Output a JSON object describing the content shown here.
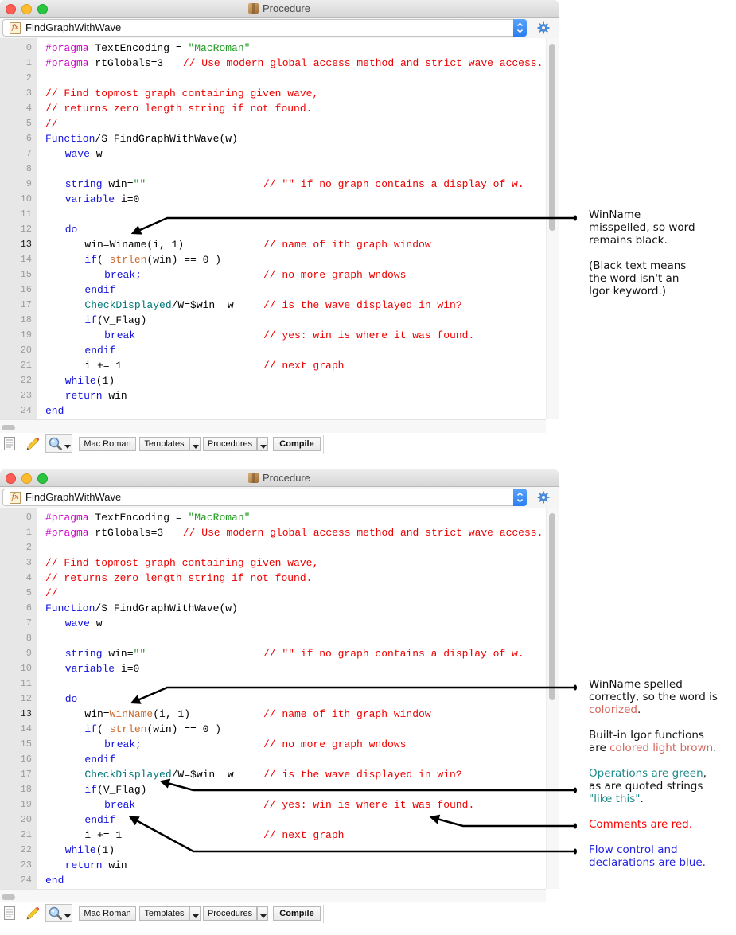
{
  "syntax_colors": {
    "plain": "#000000",
    "pragma": "#cc00c6",
    "comment": "#ee0000",
    "string": "#1f9a1f",
    "keyword": "#1212dc",
    "function": "#cc6a2c",
    "operation": "#00787a"
  },
  "annotation_colors": {
    "black": "#111111",
    "salmon": "#d6655a",
    "teal": "#1e8c8c",
    "red": "#ff0000",
    "blue": "#2424e6"
  },
  "windows": [
    {
      "title": "Procedure",
      "title_icon": "procedure-package-icon",
      "function_selector": {
        "icon_glyph": "fx",
        "value": "FindGraphWithWave"
      },
      "current_line": 13,
      "lines": [
        {
          "n": 0,
          "segments": [
            {
              "type": "pragma",
              "text": "#pragma"
            },
            {
              "type": "plain",
              "text": " TextEncoding = "
            },
            {
              "type": "string",
              "text": "\"MacRoman\""
            }
          ]
        },
        {
          "n": 1,
          "segments": [
            {
              "type": "pragma",
              "text": "#pragma"
            },
            {
              "type": "plain",
              "text": " rtGlobals=3\t"
            },
            {
              "type": "comment",
              "text": "// Use modern global access method and strict wave access."
            }
          ]
        },
        {
          "n": 2,
          "segments": []
        },
        {
          "n": 3,
          "segments": [
            {
              "type": "comment",
              "text": "// Find topmost graph containing given wave,"
            }
          ]
        },
        {
          "n": 4,
          "segments": [
            {
              "type": "comment",
              "text": "// returns zero length string if not found."
            }
          ]
        },
        {
          "n": 5,
          "segments": [
            {
              "type": "comment",
              "text": "//"
            }
          ]
        },
        {
          "n": 6,
          "segments": [
            {
              "type": "keyword",
              "text": "Function"
            },
            {
              "type": "plain",
              "text": "/S FindGraphWithWave(w)"
            }
          ]
        },
        {
          "n": 7,
          "segments": [
            {
              "type": "plain",
              "text": "\t"
            },
            {
              "type": "keyword",
              "text": "wave"
            },
            {
              "type": "plain",
              "text": " w"
            }
          ]
        },
        {
          "n": 8,
          "segments": []
        },
        {
          "n": 9,
          "segments": [
            {
              "type": "plain",
              "text": "\t"
            },
            {
              "type": "keyword",
              "text": "string"
            },
            {
              "type": "plain",
              "text": " win="
            },
            {
              "type": "string",
              "text": "\"\""
            }
          ],
          "comment": "// \"\" if no graph contains a display of w."
        },
        {
          "n": 10,
          "segments": [
            {
              "type": "plain",
              "text": "\t"
            },
            {
              "type": "keyword",
              "text": "variable"
            },
            {
              "type": "plain",
              "text": " i=0"
            }
          ]
        },
        {
          "n": 11,
          "segments": []
        },
        {
          "n": 12,
          "segments": [
            {
              "type": "plain",
              "text": "\t"
            },
            {
              "type": "keyword",
              "text": "do"
            }
          ]
        },
        {
          "n": 13,
          "segments": [
            {
              "type": "plain",
              "text": "\t\twin=Winame(i, 1)"
            }
          ],
          "comment": "// name of ith graph window"
        },
        {
          "n": 14,
          "segments": [
            {
              "type": "plain",
              "text": "\t\t"
            },
            {
              "type": "keyword",
              "text": "if"
            },
            {
              "type": "plain",
              "text": "( "
            },
            {
              "type": "function",
              "text": "strlen"
            },
            {
              "type": "plain",
              "text": "(win) == 0 )"
            }
          ]
        },
        {
          "n": 15,
          "segments": [
            {
              "type": "plain",
              "text": "\t\t\t"
            },
            {
              "type": "keyword",
              "text": "break;"
            }
          ],
          "comment": "// no more graph wndows"
        },
        {
          "n": 16,
          "segments": [
            {
              "type": "plain",
              "text": "\t\t"
            },
            {
              "type": "keyword",
              "text": "endif"
            }
          ]
        },
        {
          "n": 17,
          "segments": [
            {
              "type": "plain",
              "text": "\t\t"
            },
            {
              "type": "operation",
              "text": "CheckDisplayed"
            },
            {
              "type": "plain",
              "text": "/W=$win  w"
            }
          ],
          "comment": "// is the wave displayed in win?"
        },
        {
          "n": 18,
          "segments": [
            {
              "type": "plain",
              "text": "\t\t"
            },
            {
              "type": "keyword",
              "text": "if"
            },
            {
              "type": "plain",
              "text": "(V_Flag)"
            }
          ]
        },
        {
          "n": 19,
          "segments": [
            {
              "type": "plain",
              "text": "\t\t\t"
            },
            {
              "type": "keyword",
              "text": "break"
            }
          ],
          "comment": "// yes: win is where it was found."
        },
        {
          "n": 20,
          "segments": [
            {
              "type": "plain",
              "text": "\t\t"
            },
            {
              "type": "keyword",
              "text": "endif"
            }
          ]
        },
        {
          "n": 21,
          "segments": [
            {
              "type": "plain",
              "text": "\t\ti += 1"
            }
          ],
          "comment": "// next graph"
        },
        {
          "n": 22,
          "segments": [
            {
              "type": "plain",
              "text": "\t"
            },
            {
              "type": "keyword",
              "text": "while"
            },
            {
              "type": "plain",
              "text": "(1)"
            }
          ]
        },
        {
          "n": 23,
          "segments": [
            {
              "type": "plain",
              "text": "\t"
            },
            {
              "type": "keyword",
              "text": "return"
            },
            {
              "type": "plain",
              "text": " win"
            }
          ]
        },
        {
          "n": 24,
          "segments": [
            {
              "type": "keyword",
              "text": "end"
            }
          ]
        }
      ],
      "toolbar": {
        "encoding_button": "Mac Roman",
        "templates_button": "Templates",
        "procedures_button": "Procedures",
        "compile_button": "Compile"
      },
      "annotations": [
        {
          "lines": [
            [
              {
                "text": "WinName",
                "tone": "black"
              }
            ],
            [
              {
                "text": "misspelled, so word",
                "tone": "black"
              }
            ],
            [
              {
                "text": "remains black.",
                "tone": "black"
              }
            ],
            [],
            [
              {
                "text": "(Black text means",
                "tone": "black"
              }
            ],
            [
              {
                "text": "the word isn't an",
                "tone": "black"
              }
            ],
            [
              {
                "text": "Igor keyword.)",
                "tone": "black"
              }
            ]
          ]
        }
      ]
    },
    {
      "title": "Procedure",
      "title_icon": "procedure-package-icon",
      "function_selector": {
        "icon_glyph": "fx",
        "value": "FindGraphWithWave"
      },
      "current_line": 13,
      "lines": [
        {
          "n": 0,
          "segments": [
            {
              "type": "pragma",
              "text": "#pragma"
            },
            {
              "type": "plain",
              "text": " TextEncoding = "
            },
            {
              "type": "string",
              "text": "\"MacRoman\""
            }
          ]
        },
        {
          "n": 1,
          "segments": [
            {
              "type": "pragma",
              "text": "#pragma"
            },
            {
              "type": "plain",
              "text": " rtGlobals=3\t"
            },
            {
              "type": "comment",
              "text": "// Use modern global access method and strict wave access."
            }
          ]
        },
        {
          "n": 2,
          "segments": []
        },
        {
          "n": 3,
          "segments": [
            {
              "type": "comment",
              "text": "// Find topmost graph containing given wave,"
            }
          ]
        },
        {
          "n": 4,
          "segments": [
            {
              "type": "comment",
              "text": "// returns zero length string if not found."
            }
          ]
        },
        {
          "n": 5,
          "segments": [
            {
              "type": "comment",
              "text": "//"
            }
          ]
        },
        {
          "n": 6,
          "segments": [
            {
              "type": "keyword",
              "text": "Function"
            },
            {
              "type": "plain",
              "text": "/S FindGraphWithWave(w)"
            }
          ]
        },
        {
          "n": 7,
          "segments": [
            {
              "type": "plain",
              "text": "\t"
            },
            {
              "type": "keyword",
              "text": "wave"
            },
            {
              "type": "plain",
              "text": " w"
            }
          ]
        },
        {
          "n": 8,
          "segments": []
        },
        {
          "n": 9,
          "segments": [
            {
              "type": "plain",
              "text": "\t"
            },
            {
              "type": "keyword",
              "text": "string"
            },
            {
              "type": "plain",
              "text": " win="
            },
            {
              "type": "string",
              "text": "\"\""
            }
          ],
          "comment": "// \"\" if no graph contains a display of w."
        },
        {
          "n": 10,
          "segments": [
            {
              "type": "plain",
              "text": "\t"
            },
            {
              "type": "keyword",
              "text": "variable"
            },
            {
              "type": "plain",
              "text": " i=0"
            }
          ]
        },
        {
          "n": 11,
          "segments": []
        },
        {
          "n": 12,
          "segments": [
            {
              "type": "plain",
              "text": "\t"
            },
            {
              "type": "keyword",
              "text": "do"
            }
          ]
        },
        {
          "n": 13,
          "segments": [
            {
              "type": "plain",
              "text": "\t\twin="
            },
            {
              "type": "function",
              "text": "WinName"
            },
            {
              "type": "plain",
              "text": "(i, 1)"
            }
          ],
          "comment": "// name of ith graph window"
        },
        {
          "n": 14,
          "segments": [
            {
              "type": "plain",
              "text": "\t\t"
            },
            {
              "type": "keyword",
              "text": "if"
            },
            {
              "type": "plain",
              "text": "( "
            },
            {
              "type": "function",
              "text": "strlen"
            },
            {
              "type": "plain",
              "text": "(win) == 0 )"
            }
          ]
        },
        {
          "n": 15,
          "segments": [
            {
              "type": "plain",
              "text": "\t\t\t"
            },
            {
              "type": "keyword",
              "text": "break;"
            }
          ],
          "comment": "// no more graph wndows"
        },
        {
          "n": 16,
          "segments": [
            {
              "type": "plain",
              "text": "\t\t"
            },
            {
              "type": "keyword",
              "text": "endif"
            }
          ]
        },
        {
          "n": 17,
          "segments": [
            {
              "type": "plain",
              "text": "\t\t"
            },
            {
              "type": "operation",
              "text": "CheckDisplayed"
            },
            {
              "type": "plain",
              "text": "/W=$win  w"
            }
          ],
          "comment": "// is the wave displayed in win?"
        },
        {
          "n": 18,
          "segments": [
            {
              "type": "plain",
              "text": "\t\t"
            },
            {
              "type": "keyword",
              "text": "if"
            },
            {
              "type": "plain",
              "text": "(V_Flag)"
            }
          ]
        },
        {
          "n": 19,
          "segments": [
            {
              "type": "plain",
              "text": "\t\t\t"
            },
            {
              "type": "keyword",
              "text": "break"
            }
          ],
          "comment": "// yes: win is where it was found."
        },
        {
          "n": 20,
          "segments": [
            {
              "type": "plain",
              "text": "\t\t"
            },
            {
              "type": "keyword",
              "text": "endif"
            }
          ]
        },
        {
          "n": 21,
          "segments": [
            {
              "type": "plain",
              "text": "\t\ti += 1"
            }
          ],
          "comment": "// next graph"
        },
        {
          "n": 22,
          "segments": [
            {
              "type": "plain",
              "text": "\t"
            },
            {
              "type": "keyword",
              "text": "while"
            },
            {
              "type": "plain",
              "text": "(1)"
            }
          ]
        },
        {
          "n": 23,
          "segments": [
            {
              "type": "plain",
              "text": "\t"
            },
            {
              "type": "keyword",
              "text": "return"
            },
            {
              "type": "plain",
              "text": " win"
            }
          ]
        },
        {
          "n": 24,
          "segments": [
            {
              "type": "keyword",
              "text": "end"
            }
          ]
        }
      ],
      "toolbar": {
        "encoding_button": "Mac Roman",
        "templates_button": "Templates",
        "procedures_button": "Procedures",
        "compile_button": "Compile"
      },
      "annotations": [
        {
          "lines": [
            [
              {
                "text": "WinName spelled",
                "tone": "black"
              }
            ],
            [
              {
                "text": "correctly, so the word is",
                "tone": "black"
              }
            ],
            [
              {
                "text": "colorized",
                "tone": "salmon"
              },
              {
                "text": ".",
                "tone": "black"
              }
            ]
          ]
        },
        {
          "lines": [
            [
              {
                "text": "Built-in Igor functions",
                "tone": "black"
              }
            ],
            [
              {
                "text": "are ",
                "tone": "black"
              },
              {
                "text": "colored light brown",
                "tone": "salmon"
              },
              {
                "text": ".",
                "tone": "black"
              }
            ]
          ]
        },
        {
          "lines": [
            [
              {
                "text": "Operations are green",
                "tone": "teal"
              },
              {
                "text": ",",
                "tone": "black"
              }
            ],
            [
              {
                "text": "as are quoted strings",
                "tone": "black"
              }
            ],
            [
              {
                "text": "\"like this\"",
                "tone": "teal"
              },
              {
                "text": ".",
                "tone": "black"
              }
            ]
          ]
        },
        {
          "lines": [
            [
              {
                "text": "Comments are red.",
                "tone": "red"
              }
            ]
          ]
        },
        {
          "lines": [
            [
              {
                "text": "Flow control and",
                "tone": "blue"
              }
            ],
            [
              {
                "text": "declarations are blue.",
                "tone": "blue"
              }
            ]
          ]
        }
      ]
    }
  ]
}
